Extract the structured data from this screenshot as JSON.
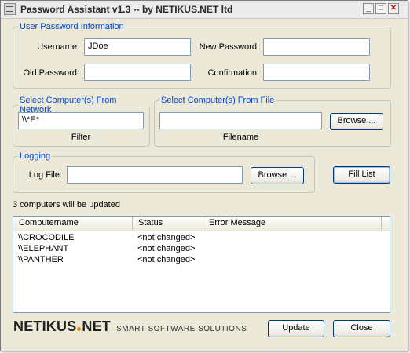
{
  "window": {
    "title": "Password Assistant v1.3 -- by NETIKUS.NET ltd",
    "minimize": "_",
    "maximize": "□",
    "close": "✕"
  },
  "user_info": {
    "legend": "User Password Information",
    "username_label": "Username:",
    "username_value": "JDoe",
    "old_password_label": "Old Password:",
    "old_password_value": "",
    "new_password_label": "New Password:",
    "new_password_value": "",
    "confirmation_label": "Confirmation:",
    "confirmation_value": ""
  },
  "network": {
    "legend": "Select Computer(s) From Network",
    "filter_value": "\\\\*E*",
    "filter_label": "Filter"
  },
  "file": {
    "legend": "Select Computer(s) From File",
    "filename_value": "",
    "browse_label": "Browse ...",
    "filename_label": "Filename"
  },
  "logging": {
    "legend": "Logging",
    "logfile_label": "Log File:",
    "logfile_value": "",
    "browse_label": "Browse ..."
  },
  "fill_list_label": "Fill List",
  "status_text": "3 computers will be updated",
  "table": {
    "columns": [
      "Computername",
      "Status",
      "Error Message"
    ],
    "rows": [
      {
        "name": "\\\\CROCODILE",
        "status": "<not changed>",
        "error": ""
      },
      {
        "name": "\\\\ELEPHANT",
        "status": "<not changed>",
        "error": ""
      },
      {
        "name": "\\\\PANTHER",
        "status": "<not changed>",
        "error": ""
      }
    ]
  },
  "footer": {
    "logo_left": "NETIKUS",
    "logo_right": "NET",
    "tagline": "SMART SOFTWARE SOLUTIONS",
    "update_label": "Update",
    "close_label": "Close"
  },
  "colors": {
    "legend_blue": "#0046d5",
    "logo_dot_orange": "#f08a00",
    "button_border": "#003c74"
  }
}
